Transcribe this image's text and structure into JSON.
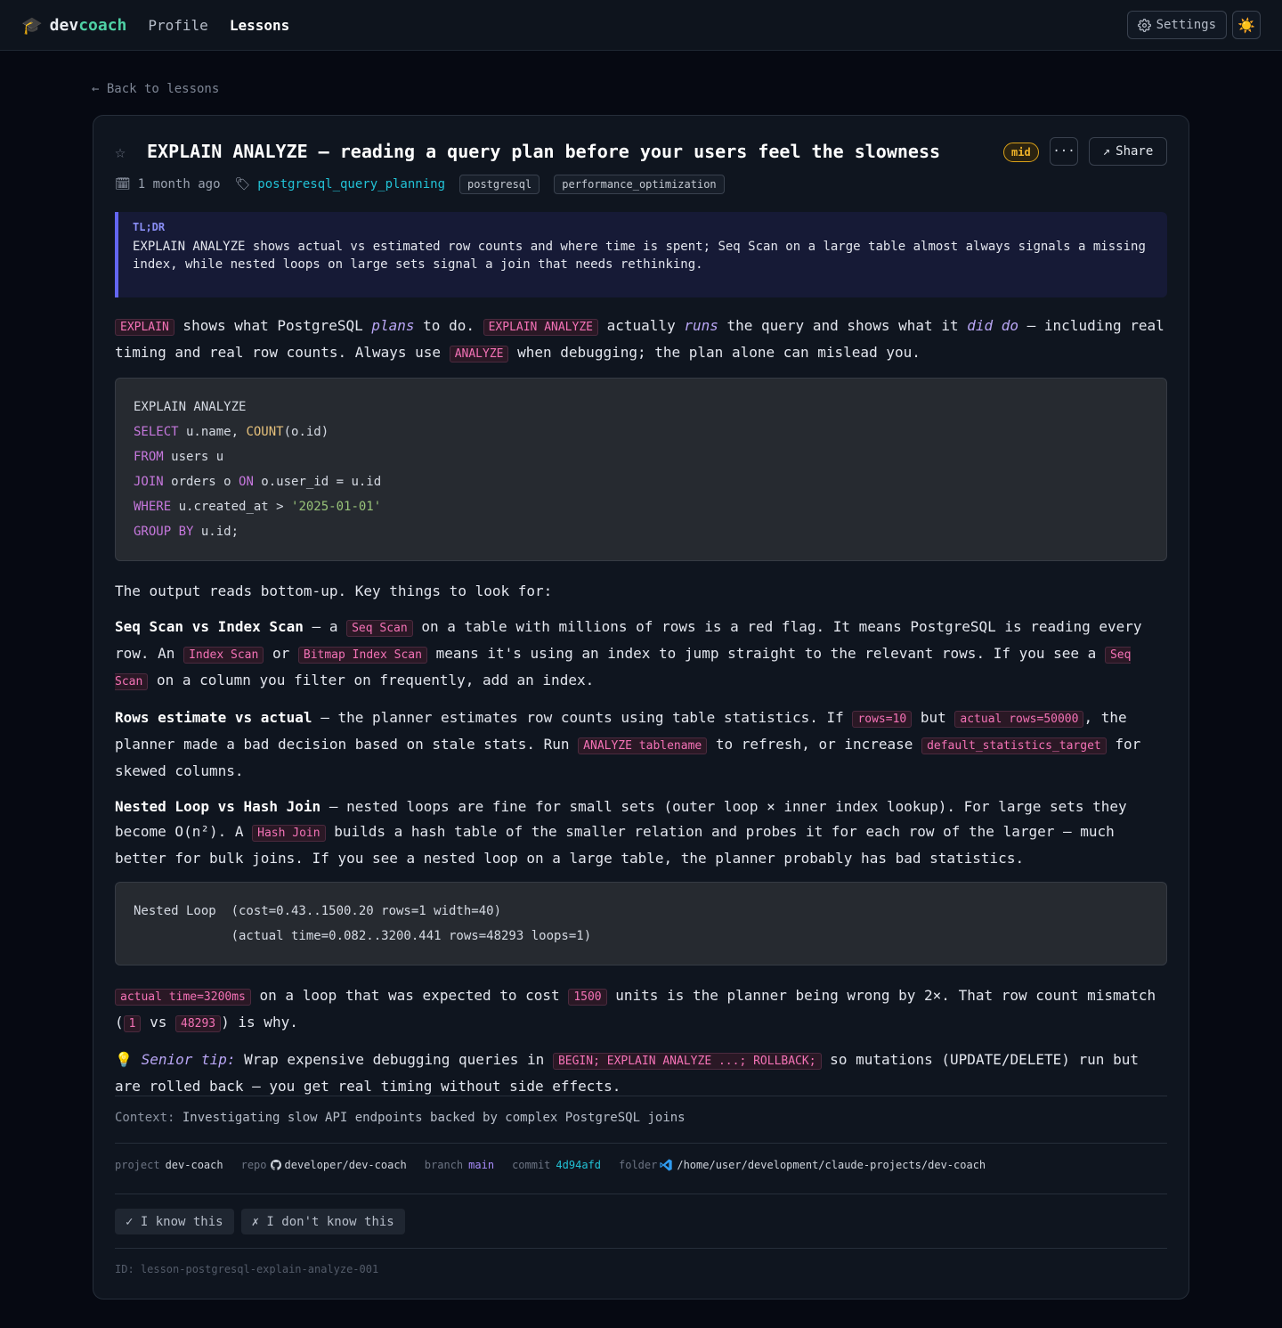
{
  "header": {
    "logo_icon": "graduation-cap-icon",
    "brand_dev": "dev",
    "brand_coach": "coach",
    "nav": [
      "Profile",
      "Lessons"
    ],
    "settings_label": "Settings",
    "theme_icon": "sun-icon"
  },
  "back_link": "← Back to lessons",
  "lesson": {
    "title": "EXPLAIN ANALYZE — reading a query plan before your users feel the slowness",
    "level": "mid",
    "more_label": "···",
    "share_label": "Share",
    "created": "1 month ago",
    "topic": "postgresql_query_planning",
    "tags": [
      "postgresql",
      "performance_optimization"
    ],
    "tldr_label": "TL;DR",
    "tldr": "EXPLAIN ANALYZE shows actual vs estimated row counts and where time is spent; Seq Scan on a large table almost always signals a missing index, while nested loops on large sets signal a join that needs rethinking.",
    "intro": {
      "c1": "EXPLAIN",
      "t1": " shows what PostgreSQL ",
      "i1": "plans",
      "t2": " to do. ",
      "c2": "EXPLAIN ANALYZE",
      "t3": " actually ",
      "i2": "runs",
      "t4": " the query and shows what it ",
      "i3": "did do",
      "t5": " — including real timing and real row counts. Always use ",
      "c3": "ANALYZE",
      "t6": " when debugging; the plan alone can mislead you."
    },
    "code1": [
      {
        "a": "EXPLAIN ANALYZE",
        "b": ""
      },
      {
        "kw": "SELECT",
        "a": " u.name, ",
        "fn": "COUNT",
        "b": "(o.id)"
      },
      {
        "kw": "FROM",
        "a": " users u"
      },
      {
        "kw": "JOIN",
        "a": " orders o ",
        "kw2": "ON",
        "b": " o.user_id = u.id"
      },
      {
        "kw": "WHERE",
        "a": " u.created_at > ",
        "str": "'2025-01-01'"
      },
      {
        "kw": "GROUP BY",
        "a": " u.id;"
      }
    ],
    "p_output": "The output reads bottom-up. Key things to look for:",
    "seq": {
      "b": "Seq Scan vs Index Scan",
      "t1": " — a ",
      "c1": "Seq Scan",
      "t2": " on a table with millions of rows is a red flag. It means PostgreSQL is reading every row. An ",
      "c2": "Index Scan",
      "t3": " or ",
      "c3": "Bitmap Index Scan",
      "t4": " means it's using an index to jump straight to the relevant rows. If you see a ",
      "c4": "Seq Scan",
      "t5": " on a column you filter on frequently, add an index."
    },
    "rows": {
      "b": "Rows estimate vs actual",
      "t1": " — the planner estimates row counts using table statistics. If ",
      "c1": "rows=10",
      "t2": " but ",
      "c2": "actual rows=50000",
      "t3": ", the planner made a bad decision based on stale stats. Run ",
      "c3": "ANALYZE tablename",
      "t4": " to refresh, or increase ",
      "c4": "default_statistics_target",
      "t5": " for skewed columns."
    },
    "nested": {
      "b": "Nested Loop vs Hash Join",
      "t1": " — nested loops are fine for small sets (outer loop × inner index lookup). For large sets they become O(n²). A ",
      "c1": "Hash Join",
      "t2": " builds a hash table of the smaller relation and probes it for each row of the larger — much better for bulk joins. If you see a nested loop on a large table, the planner probably has bad statistics."
    },
    "code2": [
      "Nested Loop  (cost=0.43..1500.20 rows=1 width=40)",
      "             (actual time=0.082..3200.441 rows=48293 loops=1)"
    ],
    "loop": {
      "c1": "actual time=3200ms",
      "t1": " on a loop that was expected to cost ",
      "c2": "1500",
      "t2": " units is the planner being wrong by 2×. That row count mismatch (",
      "c3": "1",
      "t3": " vs ",
      "c4": "48293",
      "t4": ") is why."
    },
    "tip": {
      "icon": "💡",
      "label": "Senior tip:",
      "t1": " Wrap expensive debugging queries in ",
      "c1": "BEGIN; EXPLAIN ANALYZE ...; ROLLBACK;",
      "t2": " so mutations (UPDATE/DELETE) run but are rolled back — you get real timing without side effects."
    },
    "context_label": "Context:",
    "context": "Investigating slow API endpoints backed by complex PostgreSQL joins",
    "project_meta": {
      "project_key": "project",
      "project": "dev-coach",
      "repo_key": "repo",
      "repo": "developer/dev-coach",
      "branch_key": "branch",
      "branch": "main",
      "commit_key": "commit",
      "commit": "4d94afd",
      "folder_key": "folder",
      "folder": "/home/user/development/claude-projects/dev-coach"
    },
    "know_label": "✓ I know this",
    "dont_know_label": "✗ I don't know this",
    "id_line": "ID: lesson-postgresql-explain-analyze-001"
  },
  "colors": {
    "accent": "#4fd1a5",
    "link": "#22c2d6",
    "tldr_border": "#6366f1",
    "inline_code": "#f472b6",
    "level_badge": "#f0b429"
  }
}
